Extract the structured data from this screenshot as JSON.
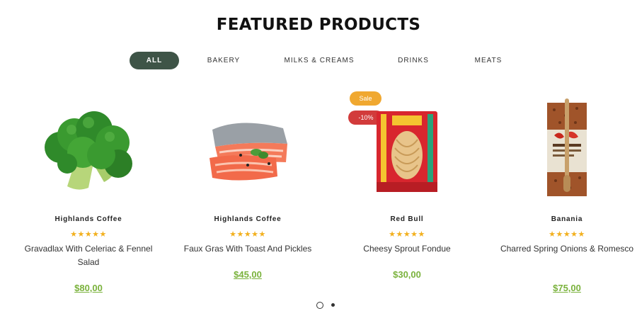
{
  "section": {
    "title": "FEATURED PRODUCTS"
  },
  "tabs": [
    {
      "label": "ALL",
      "active": true
    },
    {
      "label": "BAKERY",
      "active": false
    },
    {
      "label": "MILKS & CREAMS",
      "active": false
    },
    {
      "label": "DRINKS",
      "active": false
    },
    {
      "label": "MEATS",
      "active": false
    }
  ],
  "products": [
    {
      "vendor": "Highlands Coffee",
      "rating": 5,
      "stars": "★★★★★",
      "name": "Gravadlax With Celeriac & Fennel Salad",
      "price": "$80,00",
      "image_icon": "broccoli-image"
    },
    {
      "vendor": "Highlands Coffee",
      "rating": 5,
      "stars": "★★★★★",
      "name": "Faux Gras With Toast And Pickles",
      "price": "$45,00",
      "image_icon": "salmon-image"
    },
    {
      "vendor": "Red Bull",
      "rating": 5,
      "stars": "★★★★★",
      "name": "Cheesy Sprout Fondue",
      "price": "$30,00",
      "image_icon": "pasta-pack-image",
      "badges": {
        "sale": "Sale",
        "discount": "-10%"
      }
    },
    {
      "vendor": "Banania",
      "rating": 5,
      "stars": "★★★★★",
      "name": "Charred Spring Onions & Romesco",
      "price": "$75,00",
      "image_icon": "chili-powder-bag-image"
    }
  ],
  "pagination": {
    "pages": 2,
    "current": 1
  },
  "colors": {
    "accent": "#3e5447",
    "price": "#7ab23c",
    "star": "#f2b01e",
    "sale_badge": "#f0a830",
    "discount_badge": "#d23b3b"
  }
}
